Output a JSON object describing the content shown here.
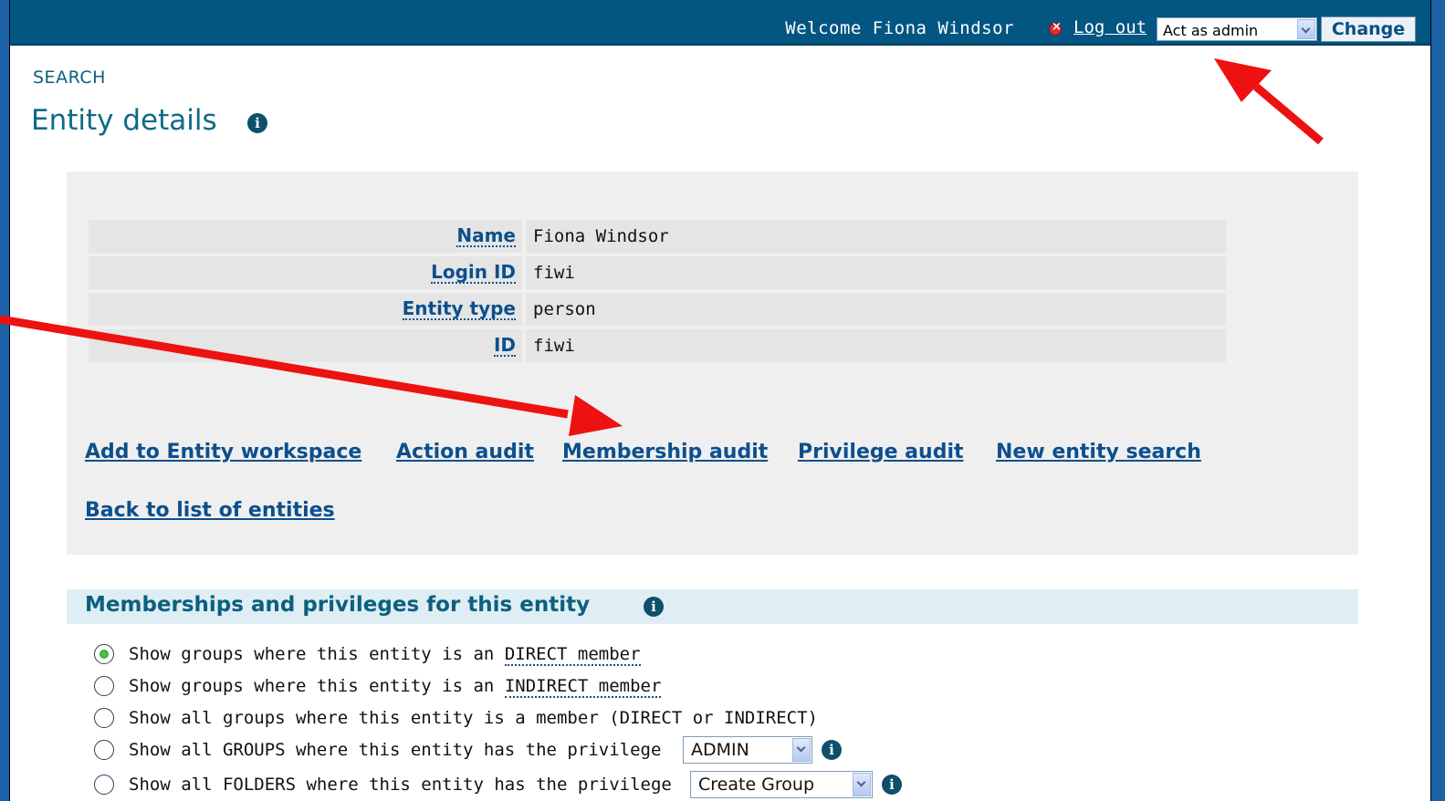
{
  "topbar": {
    "welcome_text": "Welcome Fiona Windsor",
    "logout_label": "Log out",
    "role_select_value": "Act as admin",
    "change_label": "Change"
  },
  "breadcrumb": "SEARCH",
  "page_title": "Entity details",
  "info_glyph": "i",
  "details": [
    {
      "label": "Name",
      "value": "Fiona Windsor"
    },
    {
      "label": "Login ID",
      "value": "fiwi"
    },
    {
      "label": "Entity type",
      "value": "person"
    },
    {
      "label": "ID",
      "value": "fiwi"
    }
  ],
  "actions": {
    "add_to_workspace": "Add to Entity workspace",
    "action_audit": "Action audit",
    "membership_audit": "Membership audit",
    "privilege_audit": "Privilege audit",
    "new_entity_search": "New entity search",
    "back_to_list": "Back to list of entities"
  },
  "memberships": {
    "title": "Memberships and privileges for this entity",
    "options": {
      "direct_prefix": "Show groups where this entity is an ",
      "direct_term": "DIRECT member",
      "indirect_prefix": "Show groups where this entity is an ",
      "indirect_term": "INDIRECT member",
      "all": "Show all groups where this entity is a member (DIRECT or INDIRECT)",
      "groups_priv": "Show all GROUPS where this entity has the privilege",
      "folders_priv": "Show all FOLDERS where this entity has the privilege"
    },
    "groups_priv_value": "ADMIN",
    "folders_priv_value": "Create Group",
    "selected_option": "direct"
  },
  "colors": {
    "header_bg": "#035582",
    "link": "#0d4f8d",
    "title": "#0e6a86",
    "arrow": "#ee1111"
  }
}
